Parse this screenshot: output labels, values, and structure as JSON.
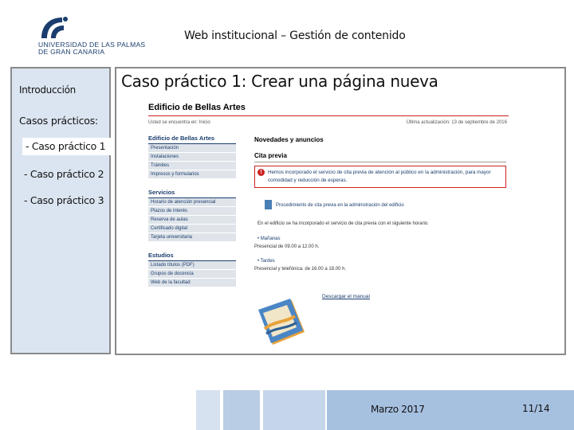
{
  "logo": {
    "line1": "UNIVERSIDAD DE LAS PALMAS",
    "line2": "DE GRAN CANARIA"
  },
  "header": {
    "title": "Web institucional – Gestión de contenido"
  },
  "sidebar": {
    "intro_label": "Introducción",
    "casos_label": "Casos prácticos:",
    "items": [
      {
        "label": "- Caso práctico 1",
        "active": true
      },
      {
        "label": "- Caso práctico 2",
        "active": false
      },
      {
        "label": "- Caso práctico 3",
        "active": false
      }
    ]
  },
  "main": {
    "title": "Caso práctico 1: Crear una página nueva"
  },
  "web": {
    "page_title": "Edificio de Bellas Artes",
    "breadcrumb": "Usted se encuentra en: Inicio",
    "last_update": "Última actualización: 13 de septiembre de 2016",
    "nav_sections": [
      {
        "heading": "Edificio de Bellas Artes",
        "items": [
          "Presentación",
          "Instalaciones",
          "Trámites",
          "Impresos y formularios"
        ]
      },
      {
        "heading": "Servicios",
        "items": [
          "Horario de atención presencial",
          "Plazos de interés",
          "Reserva de aulas",
          "Certificado digital",
          "Tarjeta universitaria"
        ]
      },
      {
        "heading": "Estudios",
        "items": [
          "Listado títulos (PDF)",
          "Grupos de docencia",
          "Web de la facultad"
        ]
      }
    ],
    "news_heading": "Novedades y anuncios",
    "cita_heading": "Cita previa",
    "alert_text": "Hemos incorporado el servicio de cita previa de atención al público en la administración, para mayor comodidad y reducción de esperas.",
    "doc_link": "Procedimiento de cita previa en la administración del edificio",
    "info_text": "En el edificio se ha incorporado el servicio de cita previa con el siguiente horario.",
    "schedule": [
      {
        "label": "Mañanas",
        "value": "Presencial de 09.00 a 12.00 h."
      },
      {
        "label": "Tardes",
        "value": "Presencial y telefónica: de 16.00 a 18.00 h."
      }
    ],
    "manual_link": "Descargar el manual"
  },
  "footer": {
    "date": "Marzo 2017",
    "page": "11/14"
  },
  "colors": {
    "sidebar_bg": "#dbe5f1",
    "accent_red": "#cc2222",
    "brand_blue": "#1a3d6d"
  }
}
